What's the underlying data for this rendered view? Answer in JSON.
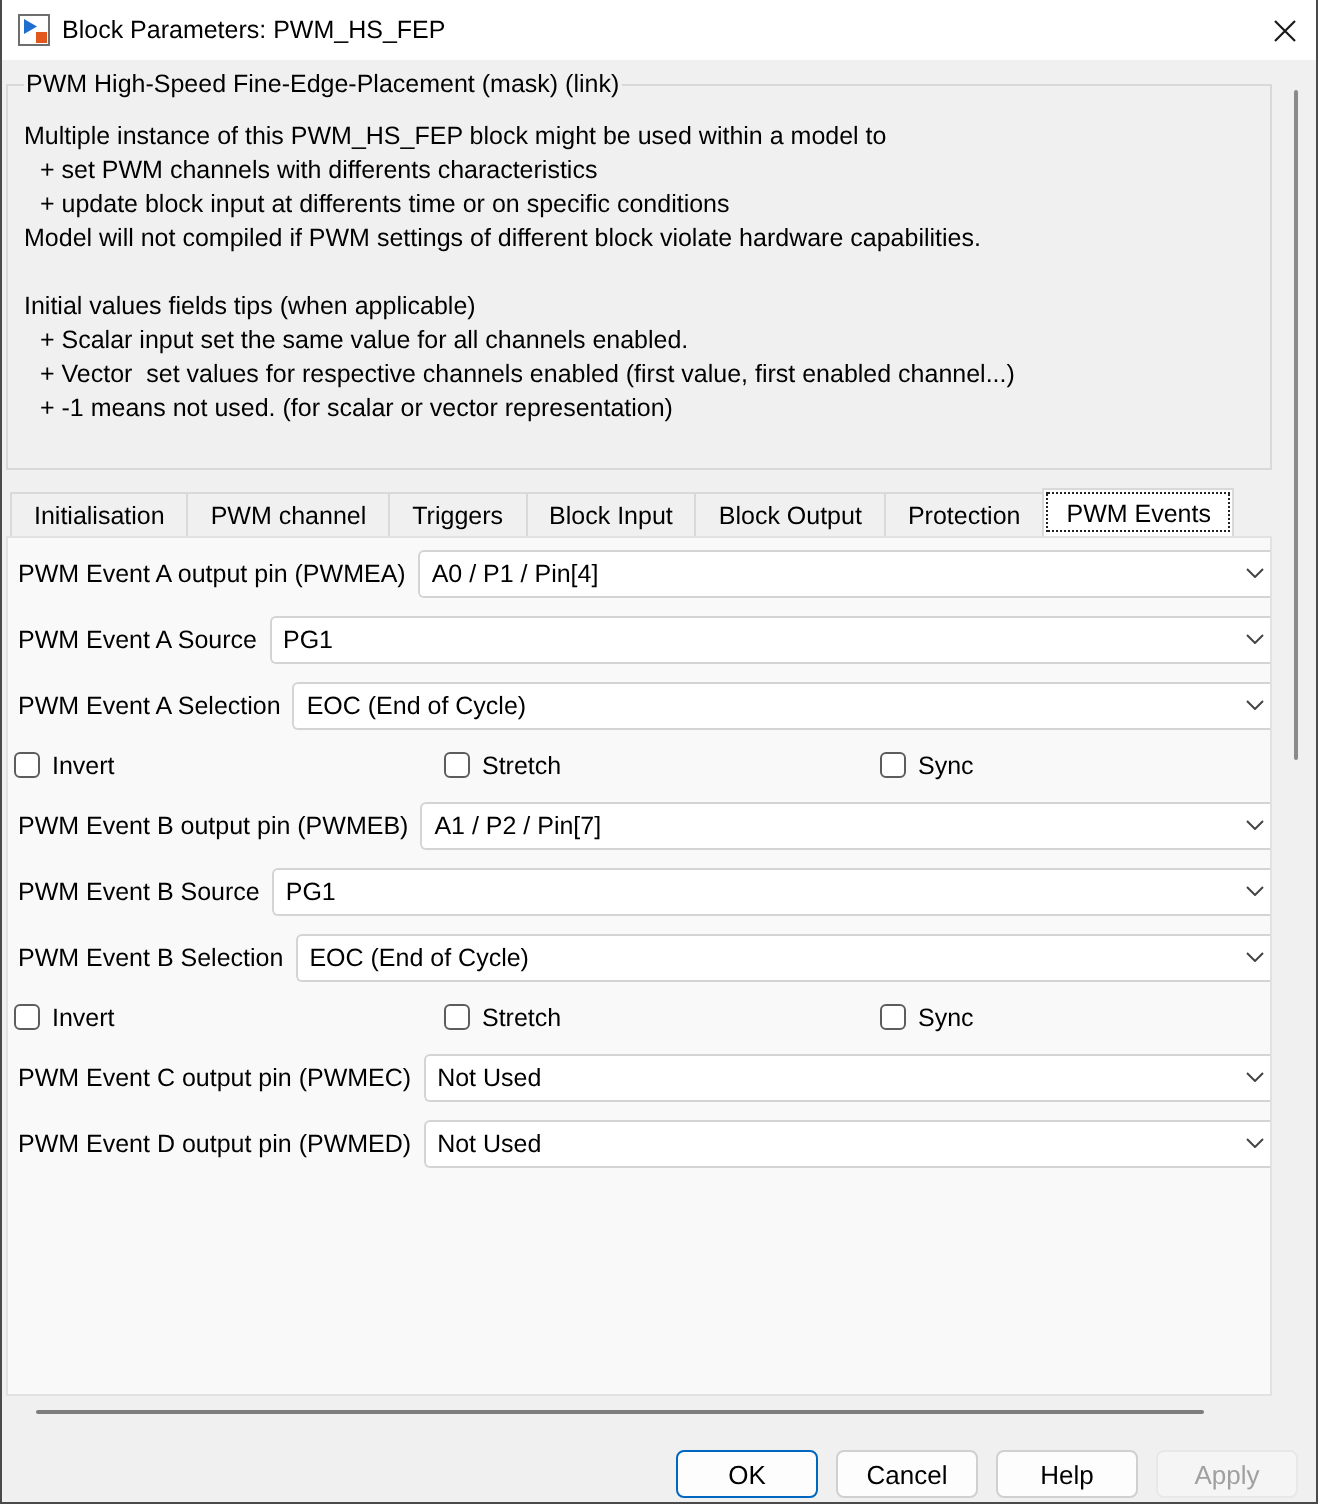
{
  "window": {
    "title": "Block Parameters: PWM_HS_FEP"
  },
  "mask": {
    "title": "PWM High-Speed Fine-Edge-Placement (mask) (link)",
    "paragraphs": [
      [
        {
          "kind": "plain",
          "text": "Multiple instance of this PWM_HS_FEP block might be used within a model to"
        },
        {
          "kind": "bullet",
          "text": "+ set PWM channels with differents characteristics"
        },
        {
          "kind": "bullet",
          "text": "+ update block input at differents time or on specific conditions"
        },
        {
          "kind": "plain",
          "text": "Model will not compiled if PWM settings of different block violate hardware capabilities."
        }
      ],
      [
        {
          "kind": "plain",
          "text": "Initial values fields tips (when applicable)"
        },
        {
          "kind": "bullet",
          "text": "+ Scalar input set the same value for all channels enabled."
        },
        {
          "kind": "bullet",
          "text": "+ Vector  set values for respective channels enabled (first value, first enabled channel...)"
        },
        {
          "kind": "bullet",
          "text": "+ -1 means not used. (for scalar or vector representation)"
        }
      ]
    ]
  },
  "tabs": [
    {
      "label": "Initialisation",
      "selected": false
    },
    {
      "label": "PWM channel",
      "selected": false
    },
    {
      "label": "Triggers",
      "selected": false
    },
    {
      "label": "Block Input",
      "selected": false
    },
    {
      "label": "Block Output",
      "selected": false
    },
    {
      "label": "Protection",
      "selected": false
    },
    {
      "label": "PWM Events",
      "selected": true
    }
  ],
  "parameters": [
    {
      "kind": "dropdown",
      "label": "PWM Event A output pin (PWMEA)",
      "value": "A0 / P1 / Pin[4]"
    },
    {
      "kind": "dropdown",
      "label": "PWM Event A Source",
      "value": "PG1"
    },
    {
      "kind": "dropdown",
      "label": "PWM Event A Selection",
      "value": "EOC (End of Cycle)"
    },
    {
      "kind": "checkboxes",
      "items": [
        {
          "label": "Invert",
          "checked": false
        },
        {
          "label": "Stretch",
          "checked": false
        },
        {
          "label": "Sync",
          "checked": false
        }
      ]
    },
    {
      "kind": "dropdown",
      "label": "PWM Event B output pin (PWMEB)",
      "value": "A1 / P2 / Pin[7]"
    },
    {
      "kind": "dropdown",
      "label": "PWM Event B Source",
      "value": "PG1"
    },
    {
      "kind": "dropdown",
      "label": "PWM Event B Selection",
      "value": "EOC (End of Cycle)"
    },
    {
      "kind": "checkboxes",
      "items": [
        {
          "label": "Invert",
          "checked": false
        },
        {
          "label": "Stretch",
          "checked": false
        },
        {
          "label": "Sync",
          "checked": false
        }
      ]
    },
    {
      "kind": "dropdown",
      "label": "PWM Event C output pin (PWMEC)",
      "value": "Not Used"
    },
    {
      "kind": "dropdown",
      "label": "PWM Event D output pin (PWMED)",
      "value": "Not Used"
    }
  ],
  "buttons": [
    {
      "label": "OK",
      "default": true,
      "disabled": false
    },
    {
      "label": "Cancel",
      "default": false,
      "disabled": false
    },
    {
      "label": "Help",
      "default": false,
      "disabled": false
    },
    {
      "label": "Apply",
      "default": false,
      "disabled": true
    }
  ]
}
